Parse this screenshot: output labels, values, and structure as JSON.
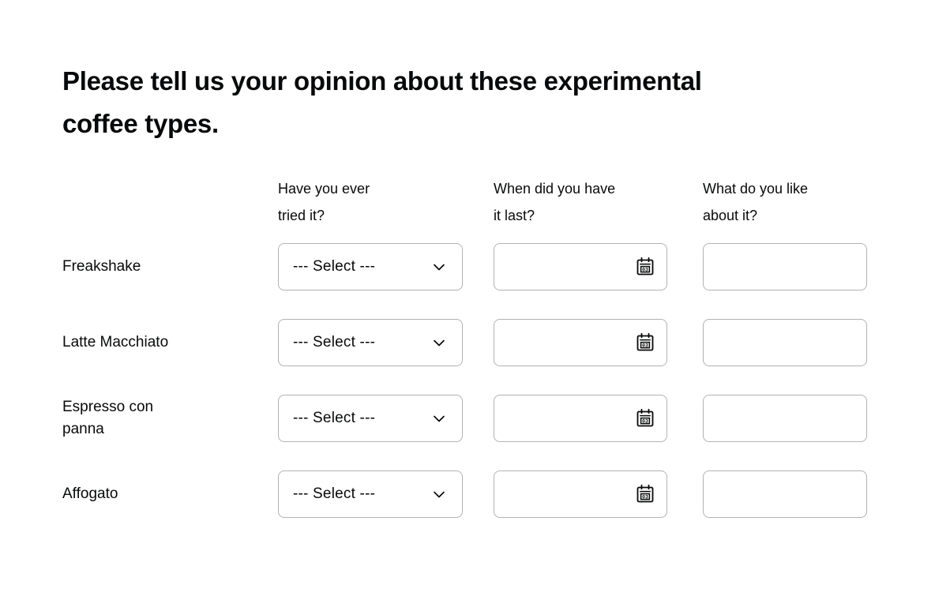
{
  "page": {
    "title": "Please tell us your opinion about these experimental\ncoffee types.",
    "background_color": "#ffffff",
    "text_color": "#08090a",
    "field_border_color": "#b3b3b3"
  },
  "matrix": {
    "row_header_label": "",
    "columns": [
      {
        "label": "Have you ever\ntried it?",
        "type": "select"
      },
      {
        "label": "When did you have\nit last?",
        "type": "date"
      },
      {
        "label": "What do you like\nabout it?",
        "type": "text"
      }
    ],
    "select_placeholder": "--- Select ---",
    "date_value": "",
    "text_value": "",
    "calendar_icon_day": "03",
    "rows": [
      {
        "label": "Freakshake",
        "select_value": "--- Select ---",
        "date_value": "",
        "text_value": ""
      },
      {
        "label": "Latte Macchiato",
        "select_value": "--- Select ---",
        "date_value": "",
        "text_value": ""
      },
      {
        "label": "Espresso con\npanna",
        "select_value": "--- Select ---",
        "date_value": "",
        "text_value": ""
      },
      {
        "label": "Affogato",
        "select_value": "--- Select ---",
        "date_value": "",
        "text_value": ""
      }
    ]
  },
  "icons": {
    "chevron": "chevron-down-icon",
    "calendar": "calendar-icon"
  }
}
